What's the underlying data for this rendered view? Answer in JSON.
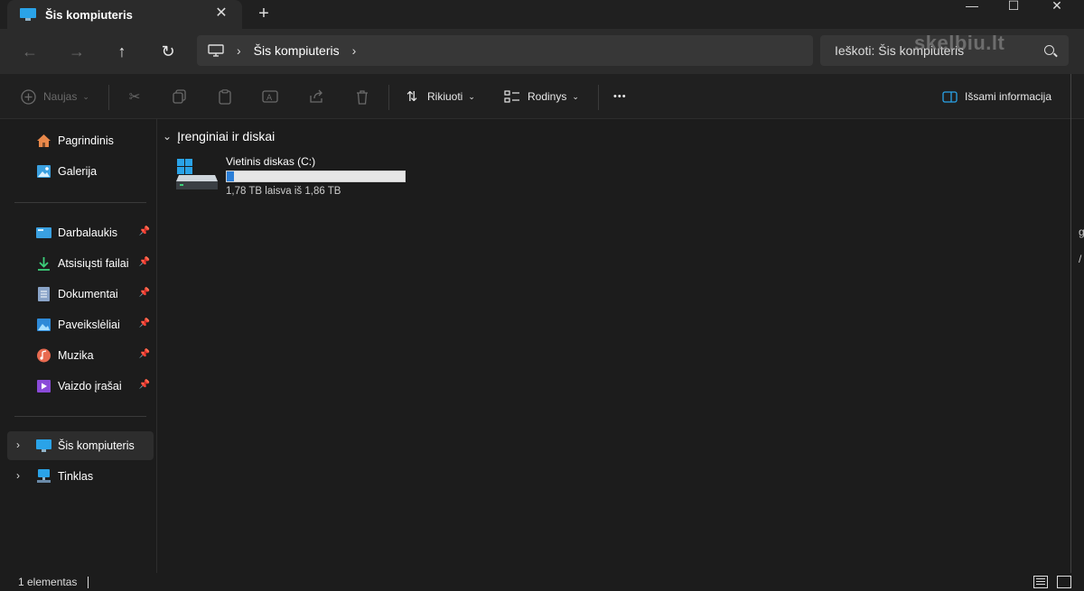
{
  "window": {
    "tab_title": "Šis kompiuteris",
    "tab_close": "✕",
    "new_tab": "+",
    "minimize": "—",
    "maximize": "☐",
    "close": "✕"
  },
  "address": {
    "back": "←",
    "forward": "→",
    "up": "↑",
    "refresh": "↻",
    "crumb_sep": "›",
    "crumb": "Šis kompiuteris",
    "search_placeholder": "Ieškoti: Šis kompiuteris"
  },
  "watermark": "skelbiu.lt",
  "toolbar": {
    "new_label": "Naujas",
    "sort_label": "Rikiuoti",
    "view_label": "Rodinys",
    "more": "•••",
    "details_label": "Išsami informacija"
  },
  "sidebar": {
    "top": [
      {
        "label": "Pagrindinis",
        "icon": "home-icon"
      },
      {
        "label": "Galerija",
        "icon": "gallery-icon"
      }
    ],
    "pinned": [
      {
        "label": "Darbalaukis",
        "icon": "desktop-icon"
      },
      {
        "label": "Atsisiųsti failai",
        "icon": "download-icon"
      },
      {
        "label": "Dokumentai",
        "icon": "document-icon"
      },
      {
        "label": "Paveikslėliai",
        "icon": "pictures-icon"
      },
      {
        "label": "Muzika",
        "icon": "music-icon"
      },
      {
        "label": "Vaizdo įrašai",
        "icon": "video-icon"
      }
    ],
    "bottom": [
      {
        "label": "Šis kompiuteris",
        "icon": "computer-icon",
        "selected": true
      },
      {
        "label": "Tinklas",
        "icon": "network-icon",
        "selected": false
      }
    ],
    "pin_glyph": "📌",
    "expand_glyph": "›"
  },
  "content": {
    "group_title": "Įrenginiai ir diskai",
    "group_chevron": "⌄",
    "drive": {
      "name": "Vietinis diskas (C:)",
      "free_text": "1,78 TB laisva iš 1,86 TB",
      "used_fraction": 0.043
    }
  },
  "status": {
    "item_count": "1 elementas"
  },
  "edge": {
    "text1": "g",
    "text2": "/"
  },
  "colors": {
    "accent": "#2b7fd8",
    "background": "#1c1c1c",
    "toolbar": "#202020"
  }
}
